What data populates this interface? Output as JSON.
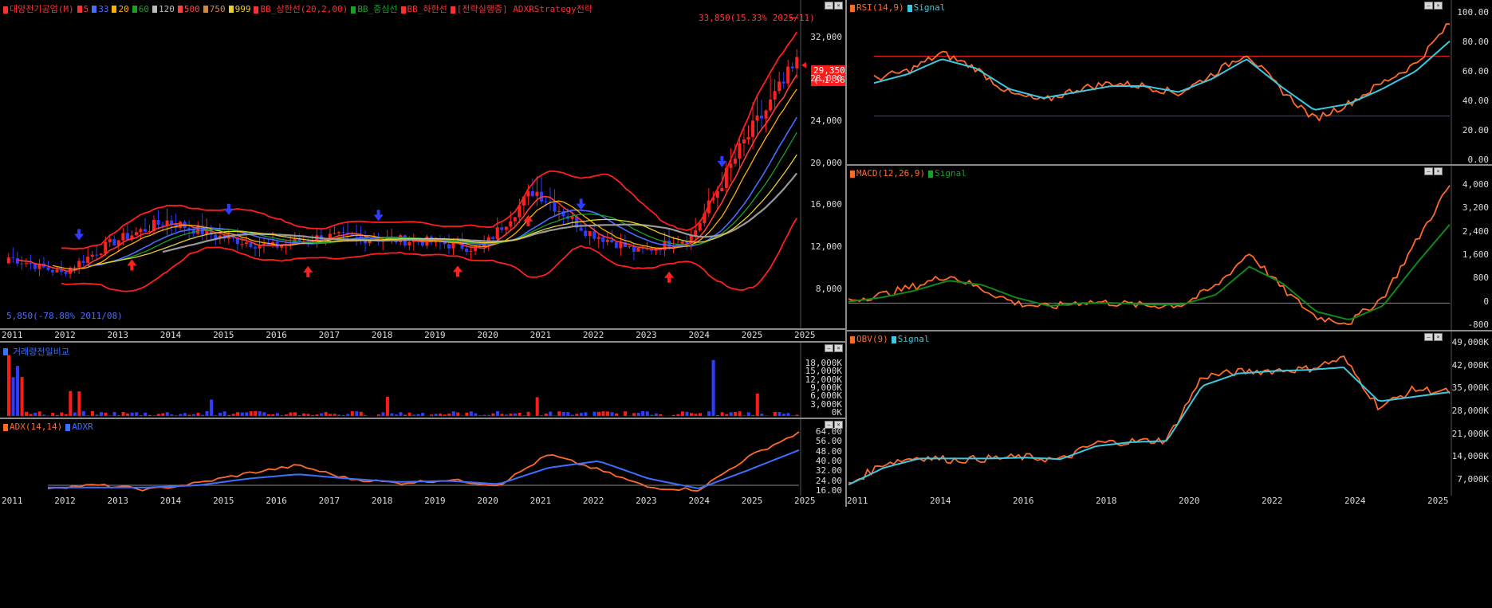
{
  "colors": {
    "bg": "#000000",
    "up": "#ff2020",
    "down": "#2f3bff",
    "bb": "#ff1e1e",
    "ma5": "#ff3a3a",
    "ma33": "#4d6bff",
    "ma20": "#ffb000",
    "ma60": "#19a02a",
    "ma120": "#9a9a9a",
    "ma500": "#ff6060",
    "ma750": "#d08a3a",
    "ma999": "#e8d030",
    "rsi": "#ff6a2a",
    "signal": "#3ec8e0",
    "macd": "#ff6a2a",
    "macdsig": "#0f8a1a",
    "adx": "#ff6a2a",
    "adxr": "#3c70ff",
    "obv": "#ff6a2a"
  },
  "main": {
    "legend": [
      {
        "label": "대양전기공업(M)",
        "color": "#ff3030"
      },
      {
        "label": "5",
        "color": "#ff3030"
      },
      {
        "label": "33",
        "color": "#4d6bff"
      },
      {
        "label": "20",
        "color": "#ffb000"
      },
      {
        "label": "60",
        "color": "#19a02a"
      },
      {
        "label": "120",
        "color": "#bbbbbb"
      },
      {
        "label": "500",
        "color": "#ff4040"
      },
      {
        "label": "750",
        "color": "#d08a3a"
      },
      {
        "label": "999",
        "color": "#e8d030"
      },
      {
        "label": "BB_상한선(20,2,00)",
        "color": "#ff3030"
      },
      {
        "label": "BB_중심선",
        "color": "#19a02a"
      },
      {
        "label": "BB_하한선",
        "color": "#ff3030"
      },
      {
        "label": "[전략실행중] ADXRStrategy전략",
        "color": "#ff3030"
      }
    ],
    "high_annotation": "33,850(15.33% 2025/11)",
    "low_annotation": "5,850(-78.88% 2011/08)",
    "price_tag_value": "29,350",
    "price_tag_pct": "(-1.56%)",
    "y_ticks": [
      "32,000",
      "28,000",
      "24,000",
      "20,000",
      "16,000",
      "12,000",
      "8,000"
    ],
    "x_labels": [
      "2011",
      "2012",
      "2013",
      "2014",
      "2015",
      "2016",
      "2017",
      "2018",
      "2019",
      "2020",
      "2021",
      "2022",
      "2023",
      "2024",
      "2025",
      "2025"
    ]
  },
  "volume": {
    "legend": "거래량전일비교",
    "y_ticks": [
      "18,000K",
      "15,000K",
      "12,000K",
      "9,000K",
      "6,000K",
      "3,000K",
      "0K"
    ]
  },
  "adx": {
    "legend": [
      {
        "label": "ADX(14,14)",
        "color": "#ff6a2a"
      },
      {
        "label": "ADXR",
        "color": "#3c70ff"
      }
    ],
    "y_ticks": [
      "64.00",
      "56.00",
      "48.00",
      "40.00",
      "32.00",
      "24.00",
      "16.00"
    ],
    "x_labels": [
      "2011",
      "2012",
      "2013",
      "2014",
      "2015",
      "2016",
      "2017",
      "2018",
      "2019",
      "2020",
      "2021",
      "2022",
      "2023",
      "2024",
      "2025",
      "2025"
    ]
  },
  "rsi": {
    "legend": [
      {
        "label": "RSI(14,9)",
        "color": "#ff6a2a"
      },
      {
        "label": "Signal",
        "color": "#3ec8e0"
      }
    ],
    "y_ticks": [
      "100.00",
      "80.00",
      "60.00",
      "40.00",
      "20.00",
      "0.00"
    ]
  },
  "macd": {
    "legend": [
      {
        "label": "MACD(12,26,9)",
        "color": "#ff6a2a"
      },
      {
        "label": "Signal",
        "color": "#19a02a"
      }
    ],
    "y_ticks": [
      "4,000",
      "3,200",
      "2,400",
      "1,600",
      "800",
      "0",
      "-800"
    ]
  },
  "obv": {
    "legend": [
      {
        "label": "OBV(9)",
        "color": "#ff6a2a"
      },
      {
        "label": "Signal",
        "color": "#3ec8e0"
      }
    ],
    "y_ticks": [
      "49,000K",
      "42,000K",
      "35,000K",
      "28,000K",
      "21,000K",
      "14,000K",
      "7,000K"
    ],
    "x_labels": [
      "2011",
      "2014",
      "2016",
      "2018",
      "2020",
      "2022",
      "2024",
      "2025"
    ]
  },
  "chart_data": [
    {
      "type": "candlestick",
      "title": "대양전기공업(M)",
      "x_unit": "month",
      "close_series": {
        "name": "대양전기공업(M)",
        "x": [
          "2011",
          "2012",
          "2013",
          "2014",
          "2015",
          "2016",
          "2017",
          "2018",
          "2019",
          "2020",
          "2021",
          "2022",
          "2023",
          "2024",
          "2025",
          "2025/11"
        ],
        "values": [
          11000,
          9500,
          12500,
          14500,
          13000,
          12000,
          13000,
          12800,
          12500,
          11800,
          17500,
          13500,
          11500,
          13000,
          22000,
          29350
        ]
      },
      "high_point": {
        "value": 33850,
        "date": "2025/11"
      },
      "low_point": {
        "value": 5850,
        "date": "2011/08"
      },
      "ylim": [
        5000,
        34500
      ]
    },
    {
      "type": "bar",
      "title": "거래량전일비교",
      "ylim": [
        0,
        21000
      ],
      "unit": "K"
    },
    {
      "type": "line",
      "title": "ADX(14,14)",
      "series": [
        {
          "name": "ADX(14,14)",
          "values": [
            18,
            20,
            16,
            22,
            31,
            38,
            26,
            22,
            25,
            20,
            48,
            34,
            18,
            16,
            46,
            68
          ]
        },
        {
          "name": "ADXR",
          "values": [
            18,
            18,
            18,
            20,
            26,
            30,
            26,
            23,
            24,
            21,
            36,
            42,
            26,
            17,
            34,
            52
          ]
        }
      ],
      "ylim": [
        12,
        70
      ]
    },
    {
      "type": "line",
      "title": "RSI(14,9)",
      "series": [
        {
          "name": "RSI(14,9)",
          "values": [
            55,
            60,
            72,
            62,
            45,
            40,
            48,
            52,
            50,
            45,
            58,
            72,
            48,
            28,
            38,
            52,
            65,
            92
          ]
        },
        {
          "name": "Signal",
          "values": [
            52,
            58,
            68,
            62,
            48,
            42,
            46,
            50,
            50,
            46,
            55,
            68,
            50,
            34,
            38,
            48,
            60,
            80
          ]
        }
      ],
      "ylim": [
        0,
        100
      ]
    },
    {
      "type": "line",
      "title": "MACD(12,26,9)",
      "series": [
        {
          "name": "MACD(12,26,9)",
          "values": [
            100,
            300,
            600,
            1000,
            500,
            0,
            -150,
            50,
            0,
            -100,
            -50,
            600,
            1800,
            500,
            -500,
            -700,
            200,
            2200,
            4200
          ]
        },
        {
          "name": "Signal",
          "values": [
            50,
            200,
            450,
            800,
            650,
            200,
            -100,
            0,
            0,
            -50,
            -50,
            300,
            1300,
            700,
            -300,
            -600,
            -100,
            1400,
            2800
          ]
        }
      ],
      "ylim": [
        -900,
        4500
      ]
    },
    {
      "type": "line",
      "title": "OBV(9)",
      "unit": "K",
      "series": [
        {
          "name": "OBV(9)",
          "values": [
            5000,
            12000,
            14000,
            13000,
            13500,
            14000,
            13000,
            18500,
            19000,
            19500,
            40000,
            41500,
            42000,
            42500,
            46000,
            30000,
            36000,
            35000
          ]
        },
        {
          "name": "Signal",
          "values": [
            5000,
            10500,
            13500,
            13500,
            13500,
            13800,
            13300,
            17500,
            18800,
            19200,
            37000,
            41000,
            41800,
            42200,
            43000,
            32000,
            33500,
            35000
          ]
        }
      ],
      "ylim": [
        2000,
        51000
      ]
    }
  ]
}
